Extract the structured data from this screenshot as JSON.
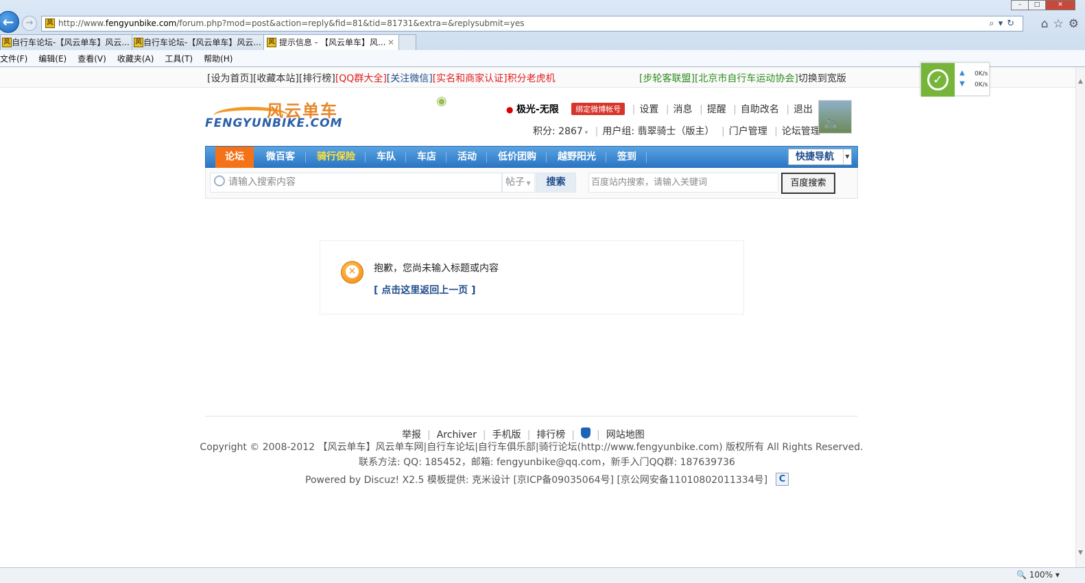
{
  "browser": {
    "url_prefix": "http://www.",
    "url_host": "fengyunbike.com",
    "url_rest": "/forum.php?mod=post&action=reply&fid=81&tid=81731&extra=&replysubmit=yes",
    "tabs": [
      {
        "label": "自行车论坛-【风云单车】风云..."
      },
      {
        "label": "自行车论坛-【风云单车】风云..."
      },
      {
        "label": "提示信息 - 【风云单车】风..."
      }
    ],
    "menu": [
      "文件(F)",
      "编辑(E)",
      "查看(V)",
      "收藏夹(A)",
      "工具(T)",
      "帮助(H)"
    ],
    "zoom": "100%"
  },
  "speed_widget": {
    "up": "0K/s",
    "down": "0K/s"
  },
  "topbar": {
    "left": [
      {
        "label": "[设为首页]",
        "color": "#333333"
      },
      {
        "label": "[收藏本站]",
        "color": "#333333"
      },
      {
        "label": "[排行榜]",
        "color": "#333333"
      },
      {
        "label": "[QQ群大全]",
        "color": "#e02020"
      },
      {
        "label": "[关注微信]",
        "color": "#1d4c8c"
      },
      {
        "label": "[实名和商家认证]",
        "color": "#e02020"
      },
      {
        "label": "积分老虎机",
        "color": "#e02020"
      }
    ],
    "right": [
      {
        "label": "[步轮客联盟]",
        "color": "#2e8b1f"
      },
      {
        "label": "[北京市自行车运动协会]",
        "color": "#2e8b1f"
      },
      {
        "label": "切换到宽版",
        "color": "#333333"
      }
    ]
  },
  "logo": {
    "cn": "风云单车",
    "en": "FENGYUNBIKE.COM"
  },
  "user": {
    "name": "极光-无限",
    "weibo_btn": "绑定微博帐号",
    "links": [
      "设置",
      "消息",
      "提醒",
      "自助改名",
      "退出"
    ],
    "points": "积分: 2867",
    "group": "用户组: 翡翠骑士（版主）",
    "admin_links": [
      "门户管理",
      "论坛管理"
    ]
  },
  "nav": {
    "items": [
      "论坛",
      "微百客",
      "骑行保险",
      "车队",
      "车店",
      "活动",
      "低价团购",
      "越野阳光",
      "签到"
    ],
    "quick_nav": "快捷导航"
  },
  "search": {
    "placeholder": "请输入搜索内容",
    "type": "帖子",
    "button": "搜索",
    "baidu_placeholder": "百度站内搜索，请输入关键词",
    "baidu_button": "百度搜索"
  },
  "message": {
    "text": "抱歉，您尚未输入标题或内容",
    "link": "[ 点击这里返回上一页 ]"
  },
  "footer": {
    "links": [
      "举报",
      "Archiver",
      "手机版",
      "排行榜",
      "网站地图"
    ],
    "copyright": "Copyright © 2008-2012 【风云单车】风云单车网|自行车论坛|自行车俱乐部|骑行论坛(http://www.fengyunbike.com) 版权所有  All Rights Reserved.",
    "contact": "联系方法: QQ: 185452，邮箱: fengyunbike@qq.com，新手入门QQ群: 187639736",
    "powered": "Powered by Discuz! X2.5  模板提供: 克米设计  [京ICP备09035064号] [京公网安备11010802011334号]"
  }
}
